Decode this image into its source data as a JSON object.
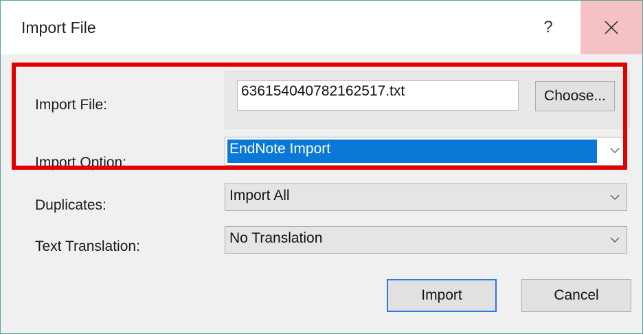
{
  "window": {
    "title": "Import File",
    "help_glyph": "?"
  },
  "import_file": {
    "label": "Import File:",
    "value": "636154040782162517.txt",
    "choose_label": "Choose..."
  },
  "import_option": {
    "label": "Import Option:",
    "value": "EndNote Import"
  },
  "duplicates": {
    "label": "Duplicates:",
    "value": "Import All"
  },
  "text_translation": {
    "label": "Text Translation:",
    "value": "No Translation"
  },
  "buttons": {
    "import_label": "Import",
    "cancel_label": "Cancel"
  },
  "colors": {
    "selection": "#0a78d7",
    "close_hover": "#f4c2c5",
    "annotation": "#e00000"
  }
}
